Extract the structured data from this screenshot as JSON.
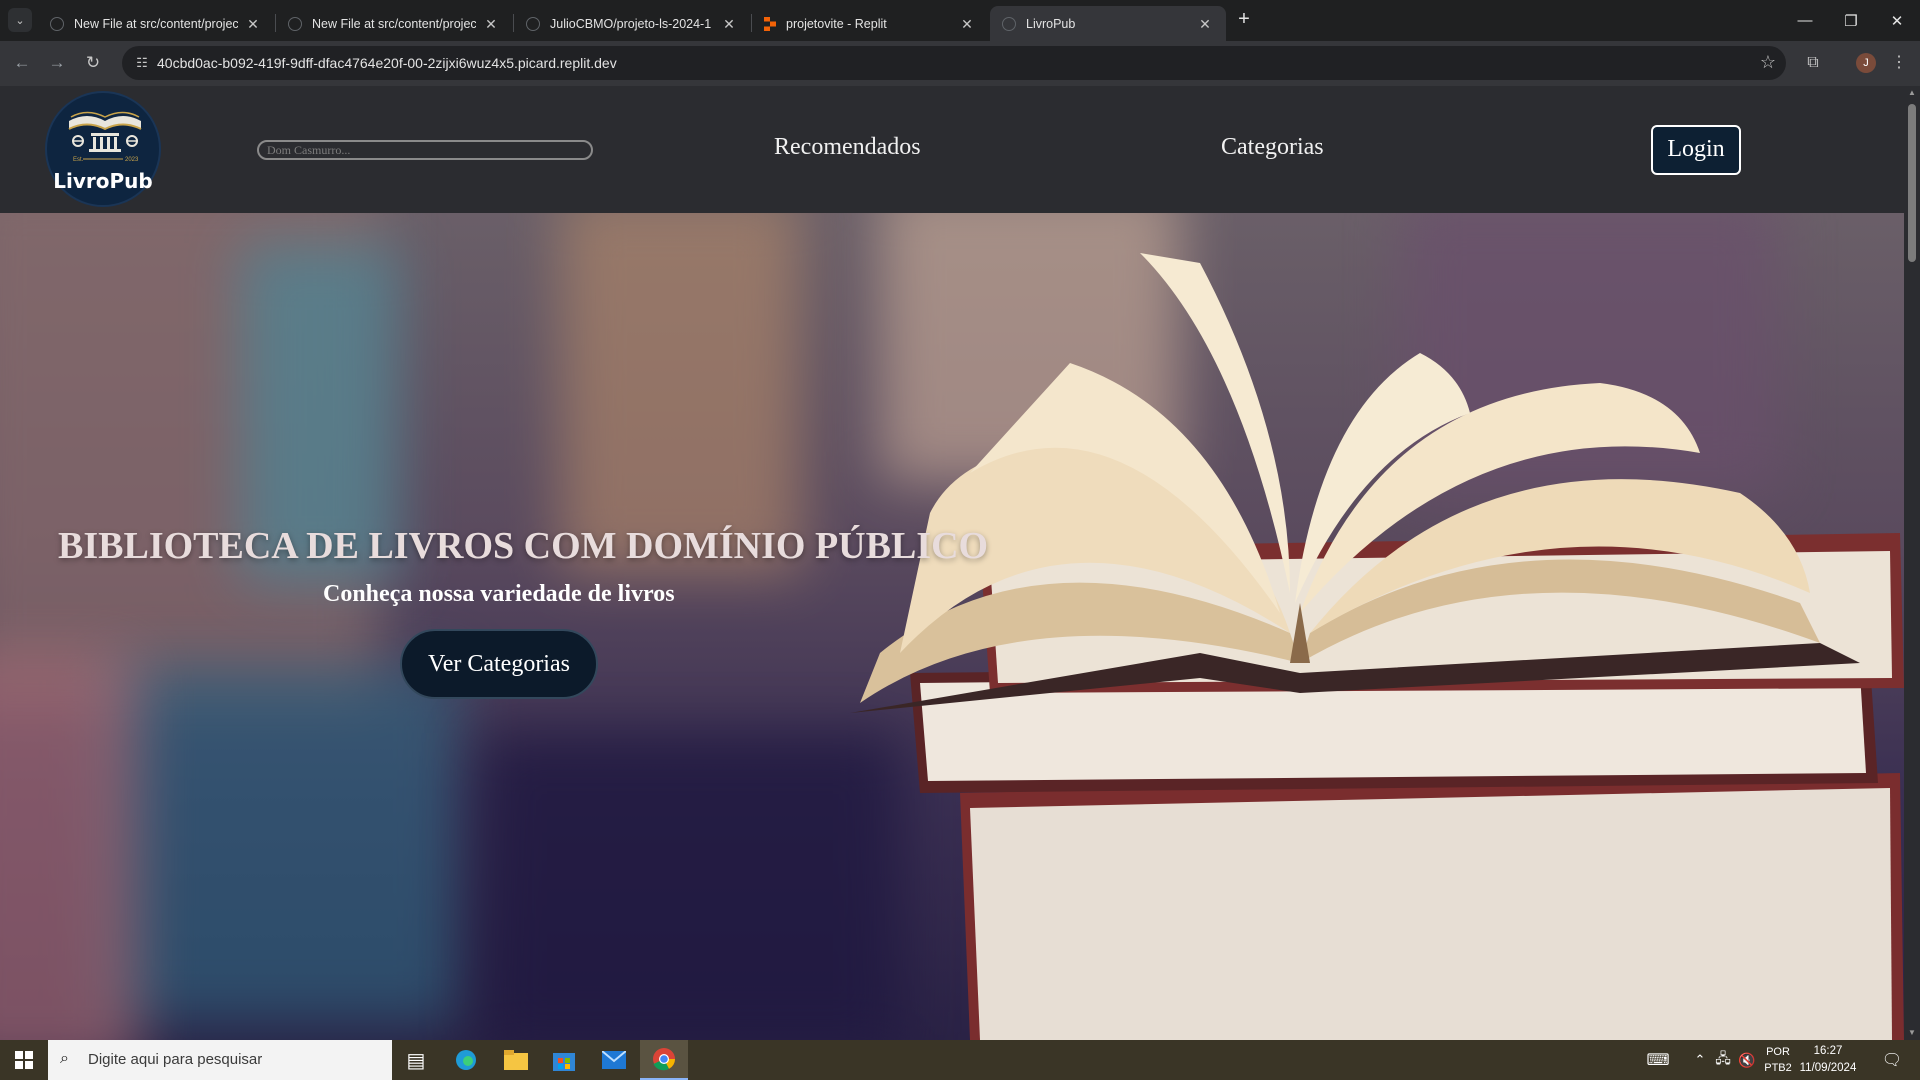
{
  "browser": {
    "tabs": [
      {
        "title": "New File at src/content/projects",
        "active": false
      },
      {
        "title": "New File at src/content/projects",
        "active": false
      },
      {
        "title": "JulioCBMO/projeto-ls-2024-1",
        "active": false
      },
      {
        "title": "projetovite - Replit",
        "active": false
      },
      {
        "title": "LivroPub",
        "active": true
      }
    ],
    "url": "40cbd0ac-b092-419f-9dff-dfac4764e20f-00-2zijxi6wuz4x5.picard.replit.dev",
    "profile_initial": "J"
  },
  "site": {
    "logo_text": "LivroPub",
    "logo_small_left": "Est.",
    "logo_small_right": "2023",
    "search_placeholder": "Dom Casmurro...",
    "nav": {
      "recomendados": "Recomendados",
      "categorias": "Categorias",
      "login": "Login"
    },
    "hero": {
      "title": "BIBLIOTECA DE LIVROS COM DOMÍNIO PÚBLICO",
      "subtitle": "Conheça nossa variedade de livros",
      "button": "Ver Categorias"
    }
  },
  "taskbar": {
    "search_placeholder": "Digite aqui para pesquisar",
    "language": "POR",
    "layout": "PTB2",
    "time": "16:27",
    "date": "11/09/2024"
  },
  "colors": {
    "header_bg": "#2b2c30",
    "login_bg": "#0d2033",
    "logo_bg": "#0e2540",
    "hero_button_bg": "#0c1a2a",
    "taskbar_bg": "#3a3526"
  }
}
